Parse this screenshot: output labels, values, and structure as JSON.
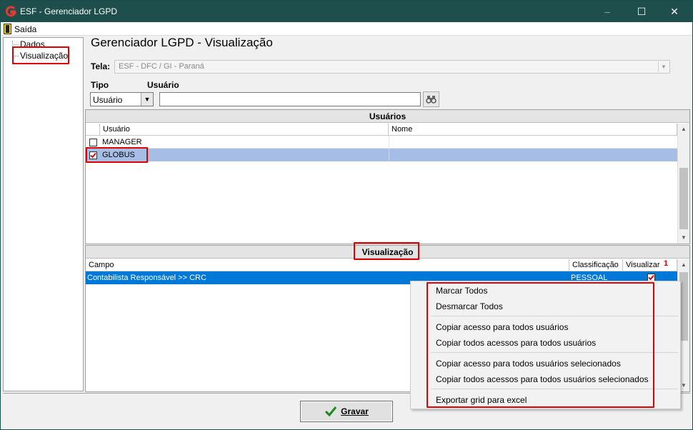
{
  "window": {
    "title": "ESF - Gerenciador LGPD",
    "minimize": "‒",
    "maximize": "☐",
    "close": "✕"
  },
  "menu": {
    "exit_label": "Saída"
  },
  "tree": {
    "items": [
      {
        "label": "Dados"
      },
      {
        "label": "Visualização"
      }
    ]
  },
  "page": {
    "heading": "Gerenciador LGPD - Visualização"
  },
  "tela": {
    "label": "Tela:",
    "value": "ESF - DFC / GI - Paraná"
  },
  "filters": {
    "tipo_label": "Tipo",
    "tipo_value": "Usuário",
    "usuario_label": "Usuário",
    "usuario_value": ""
  },
  "users_grid": {
    "title": "Usuários",
    "columns": [
      "Usuário",
      "Nome"
    ],
    "rows": [
      {
        "user": "MANAGER",
        "name": "",
        "checked": false
      },
      {
        "user": "GLOBUS",
        "name": "",
        "checked": true
      }
    ]
  },
  "visualizacao_grid": {
    "title": "Visualização",
    "columns": [
      "Campo",
      "Classificação",
      "Visualizar"
    ],
    "sort_indicator": "1",
    "rows": [
      {
        "campo": "Contabilista Responsável >> CRC",
        "classificacao": "PESSOAL",
        "visualizar": true
      }
    ]
  },
  "context_menu": {
    "items": [
      "Marcar Todos",
      "Desmarcar Todos",
      "Copiar acesso para todos usuários",
      "Copiar todos acessos para todos usuários",
      "Copiar acesso para todos usuários selecionados",
      "Copiar todos acessos para todos usuários selecionados",
      "Exportar grid para excel"
    ]
  },
  "footer": {
    "save_label": "Gravar"
  },
  "colors": {
    "titlebar": "#1f4f4c",
    "selected_row": "#a6bde6",
    "selected_row_active": "#0078d7",
    "highlight_box": "#e00000",
    "check_red": "#d00000"
  }
}
